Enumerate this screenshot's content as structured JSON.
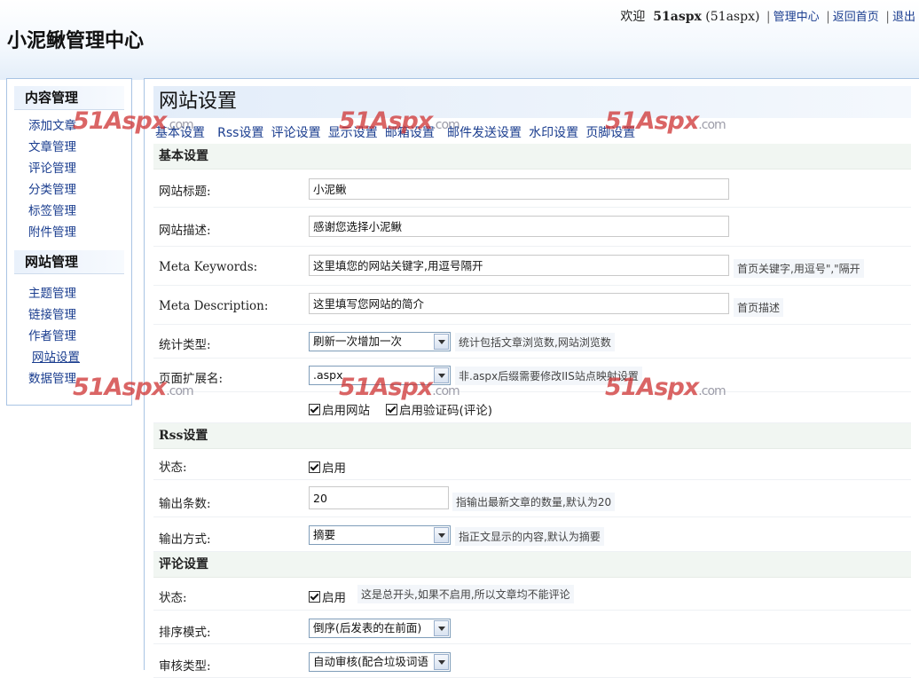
{
  "header": {
    "site_title": "小泥鳅管理中心",
    "welcome": "欢迎",
    "username": "51aspx",
    "username_paren": "(51aspx)",
    "links": [
      "管理中心",
      "返回首页",
      "退出"
    ]
  },
  "sidebar": {
    "groups": [
      {
        "title": "内容管理",
        "items": [
          "添加文章",
          "文章管理",
          "评论管理",
          "分类管理",
          "标签管理",
          "附件管理"
        ]
      },
      {
        "title": "网站管理",
        "items": [
          "主题管理",
          "链接管理",
          "作者管理",
          "网站设置",
          "数据管理"
        ]
      }
    ],
    "active_item": "网站设置"
  },
  "main": {
    "title": "网站设置",
    "tabs": [
      "基本设置",
      "Rss设置",
      "评论设置",
      "显示设置",
      "邮箱设置",
      "邮件发送设置",
      "水印设置",
      "页脚设置"
    ]
  },
  "basic": {
    "section_title": "基本设置",
    "site_title_label": "网站标题:",
    "site_title_value": "小泥鳅",
    "site_desc_label": "网站描述:",
    "site_desc_value": "感谢您选择小泥鳅",
    "meta_kw_label": "Meta Keywords:",
    "meta_kw_value": "这里填您的网站关键字,用逗号隔开",
    "meta_kw_hint": "首页关键字,用逗号\",\"隔开",
    "meta_desc_label": "Meta Description:",
    "meta_desc_value": "这里填写您网站的简介",
    "meta_desc_hint": "首页描述",
    "stat_label": "统计类型:",
    "stat_value": "刷新一次增加一次",
    "stat_hint": "统计包括文章浏览数,网站浏览数",
    "ext_label": "页面扩展名:",
    "ext_value": ".aspx",
    "ext_hint": "非.aspx后缀需要修改IIS站点映射设置",
    "enable_site": "启用网站",
    "enable_captcha": "启用验证码(评论)"
  },
  "rss": {
    "section_title": "Rss设置",
    "status_label": "状态:",
    "status_check": "启用",
    "count_label": "输出条数:",
    "count_value": "20",
    "count_hint": "指输出最新文章的数量,默认为20",
    "mode_label": "输出方式:",
    "mode_value": "摘要",
    "mode_hint": "指正文显示的内容,默认为摘要"
  },
  "comment": {
    "section_title": "评论设置",
    "status_label": "状态:",
    "status_check": "启用",
    "status_hint": "这是总开头,如果不启用,所以文章均不能评论",
    "order_label": "排序模式:",
    "order_value": "倒序(后发表的在前面)",
    "audit_label": "审核类型:",
    "audit_value": "自动审核(配合垃圾词语"
  },
  "watermark": {
    "text": "51Aspx",
    "suffix": ".com"
  }
}
